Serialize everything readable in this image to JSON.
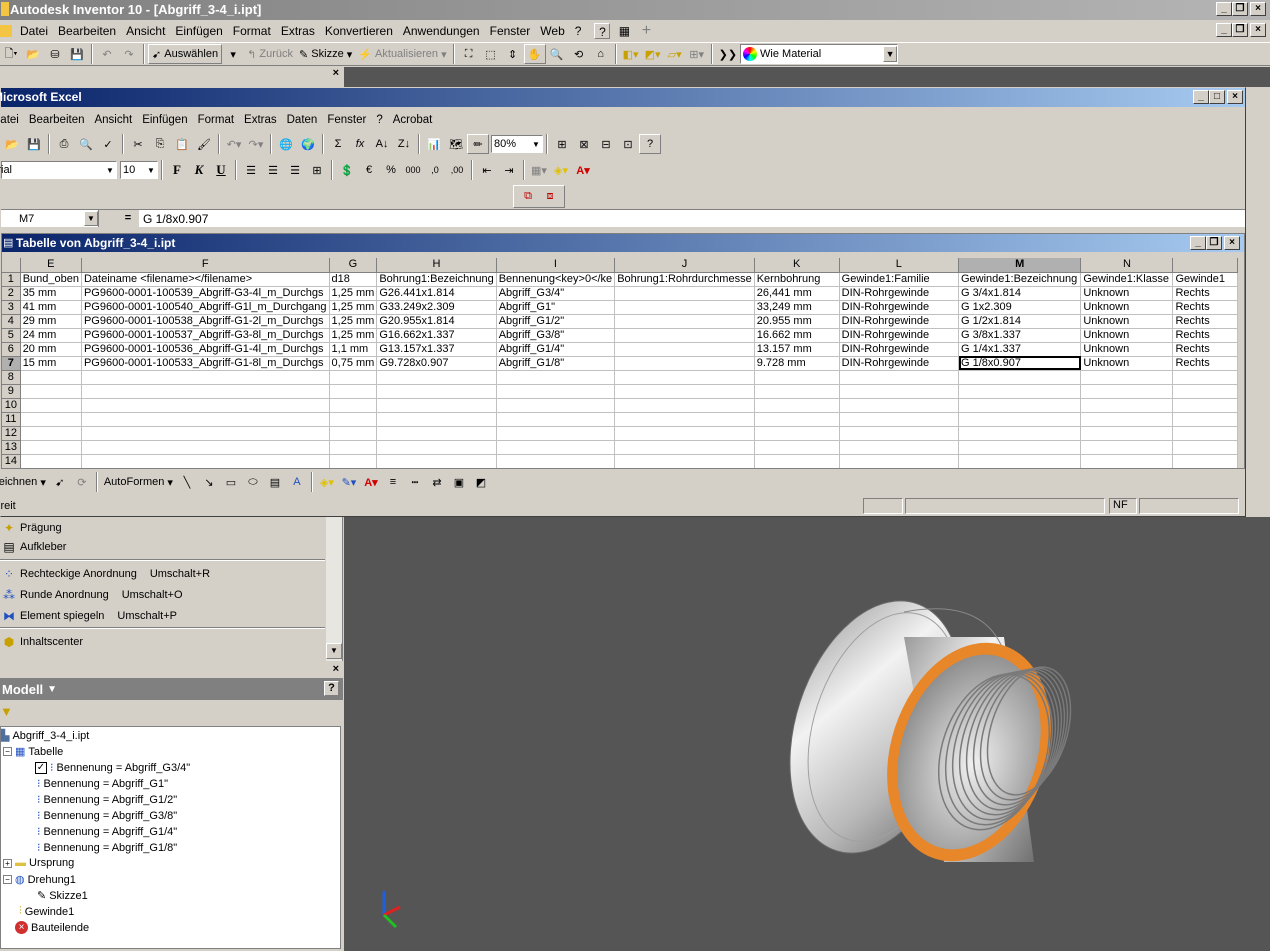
{
  "titlebar": {
    "title": "Autodesk Inventor 10 - [Abgriff_3-4_i.ipt]"
  },
  "menubar": {
    "items": [
      "Datei",
      "Bearbeiten",
      "Ansicht",
      "Einfügen",
      "Format",
      "Extras",
      "Konvertieren",
      "Anwendungen",
      "Fenster",
      "Web",
      "?"
    ]
  },
  "toolbar": {
    "select_label": "Auswählen",
    "back_label": "Zurück",
    "sketch_label": "Skizze",
    "update_label": "Aktualisieren",
    "material_value": "Wie Material"
  },
  "excel": {
    "title": "Microsoft Excel",
    "menu": [
      "Datei",
      "Bearbeiten",
      "Ansicht",
      "Einfügen",
      "Format",
      "Extras",
      "Daten",
      "Fenster",
      "?",
      "Acrobat"
    ],
    "zoom": "80%",
    "font_name": "Arial",
    "font_size": "10",
    "name_box": "M7",
    "formula_eq": "=",
    "formula": "G 1/8x0.907",
    "workbook_title": "Tabelle von Abgriff_3-4_i.ipt",
    "draw_label": "Zeichnen",
    "autoshapes_label": "AutoFormen",
    "status_left": "Bereit",
    "status_nf": "NF",
    "columns": [
      "E",
      "F",
      "G",
      "H",
      "I",
      "J",
      "K",
      "L",
      "M",
      "N",
      ""
    ],
    "rows": [
      [
        "Bund_oben",
        "Dateiname <filename></filename>",
        "d18",
        "Bohrung1:Bezeichnung",
        "Bennenung<key>0</ke",
        "Bohrung1:Rohrdurchmesse",
        "Kernbohrung",
        "Gewinde1:Familie",
        "Gewinde1:Bezeichnung",
        "Gewinde1:Klasse",
        "Gewinde1"
      ],
      [
        "35 mm",
        "PG9600-0001-100539_Abgriff-G3-4l_m_Durchgs",
        "1,25 mm",
        "G26.441x1.814",
        "Abgriff_G3/4\"",
        "",
        "26,441 mm",
        "DIN-Rohrgewinde",
        "G 3/4x1.814",
        "Unknown",
        "Rechts"
      ],
      [
        "41 mm",
        "PG9600-0001-100540_Abgriff-G1l_m_Durchgang",
        "1,25 mm",
        "G33.249x2.309",
        "Abgriff_G1\"",
        "",
        "33,249 mm",
        "DIN-Rohrgewinde",
        "G 1x2.309",
        "Unknown",
        "Rechts"
      ],
      [
        "29 mm",
        "PG9600-0001-100538_Abgriff-G1-2l_m_Durchgs",
        "1,25 mm",
        "G20.955x1.814",
        "Abgriff_G1/2\"",
        "",
        "20.955 mm",
        "DIN-Rohrgewinde",
        "G 1/2x1.814",
        "Unknown",
        "Rechts"
      ],
      [
        "24 mm",
        "PG9600-0001-100537_Abgriff-G3-8l_m_Durchgs",
        "1,25 mm",
        "G16.662x1.337",
        "Abgriff_G3/8\"",
        "",
        "16.662 mm",
        "DIN-Rohrgewinde",
        "G 3/8x1.337",
        "Unknown",
        "Rechts"
      ],
      [
        "20 mm",
        "PG9600-0001-100536_Abgriff-G1-4l_m_Durchgs",
        "1,1 mm",
        "G13.157x1.337",
        "Abgriff_G1/4\"",
        "",
        "13.157 mm",
        "DIN-Rohrgewinde",
        "G 1/4x1.337",
        "Unknown",
        "Rechts"
      ],
      [
        "15 mm",
        "PG9600-0001-100533_Abgriff-G1-8l_m_Durchgs",
        "0,75 mm",
        "G9.728x0.907",
        "Abgriff_G1/8\"",
        "",
        "9.728 mm",
        "DIN-Rohrgewinde",
        "G 1/8x0.907",
        "Unknown",
        "Rechts"
      ]
    ],
    "row_numbers": [
      "1",
      "2",
      "3",
      "4",
      "5",
      "6",
      "7",
      "8",
      "9",
      "10",
      "11",
      "12",
      "13",
      "14"
    ]
  },
  "panel": {
    "items": [
      {
        "label": "Prägung",
        "shortcut": ""
      },
      {
        "label": "Aufkleber",
        "shortcut": ""
      },
      {
        "label": "Rechteckige Anordnung",
        "shortcut": "Umschalt+R"
      },
      {
        "label": "Runde Anordnung",
        "shortcut": "Umschalt+O"
      },
      {
        "label": "Element spiegeln",
        "shortcut": "Umschalt+P"
      },
      {
        "label": "Inhaltscenter",
        "shortcut": ""
      }
    ]
  },
  "browser": {
    "header": "Modell",
    "root": "Abgriff_3-4_i.ipt",
    "table": "Tabelle",
    "variants": [
      "Bennenung = Abgriff_G3/4\"",
      "Bennenung = Abgriff_G1\"",
      "Bennenung = Abgriff_G1/2\"",
      "Bennenung = Abgriff_G3/8\"",
      "Bennenung = Abgriff_G1/4\"",
      "Bennenung = Abgriff_G1/8\""
    ],
    "origin": "Ursprung",
    "revolve": "Drehung1",
    "sketch": "Skizze1",
    "thread": "Gewinde1",
    "parts": "Bauteilende"
  },
  "colors": {
    "titlebar": "#0a246a",
    "viewport": "#555555",
    "selection_border": "#000000",
    "thread_face": "#e8862a"
  }
}
